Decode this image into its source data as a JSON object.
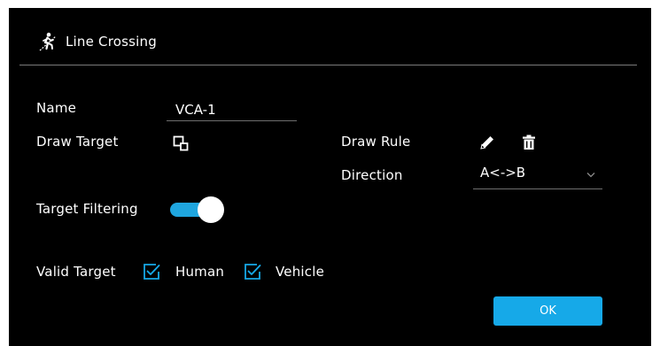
{
  "dialog": {
    "title": "Line Crossing",
    "title_icon": "pedestrian-crossing-icon"
  },
  "form": {
    "name_label": "Name",
    "name_value": "VCA-1",
    "draw_target_label": "Draw Target",
    "draw_target_icon": "draw-rectangle-icon",
    "draw_rule_label": "Draw Rule",
    "draw_rule_icons": [
      "pencil-icon",
      "trash-icon"
    ],
    "direction_label": "Direction",
    "direction_value": "A<->B",
    "target_filtering_label": "Target Filtering",
    "target_filtering_on": true,
    "valid_target_label": "Valid Target",
    "valid_targets": [
      {
        "label": "Human",
        "checked": true
      },
      {
        "label": "Vehicle",
        "checked": true
      }
    ]
  },
  "actions": {
    "ok_label": "OK"
  },
  "colors": {
    "background": "#000000",
    "accent": "#16a9e8",
    "divider": "#7a7a7a"
  }
}
